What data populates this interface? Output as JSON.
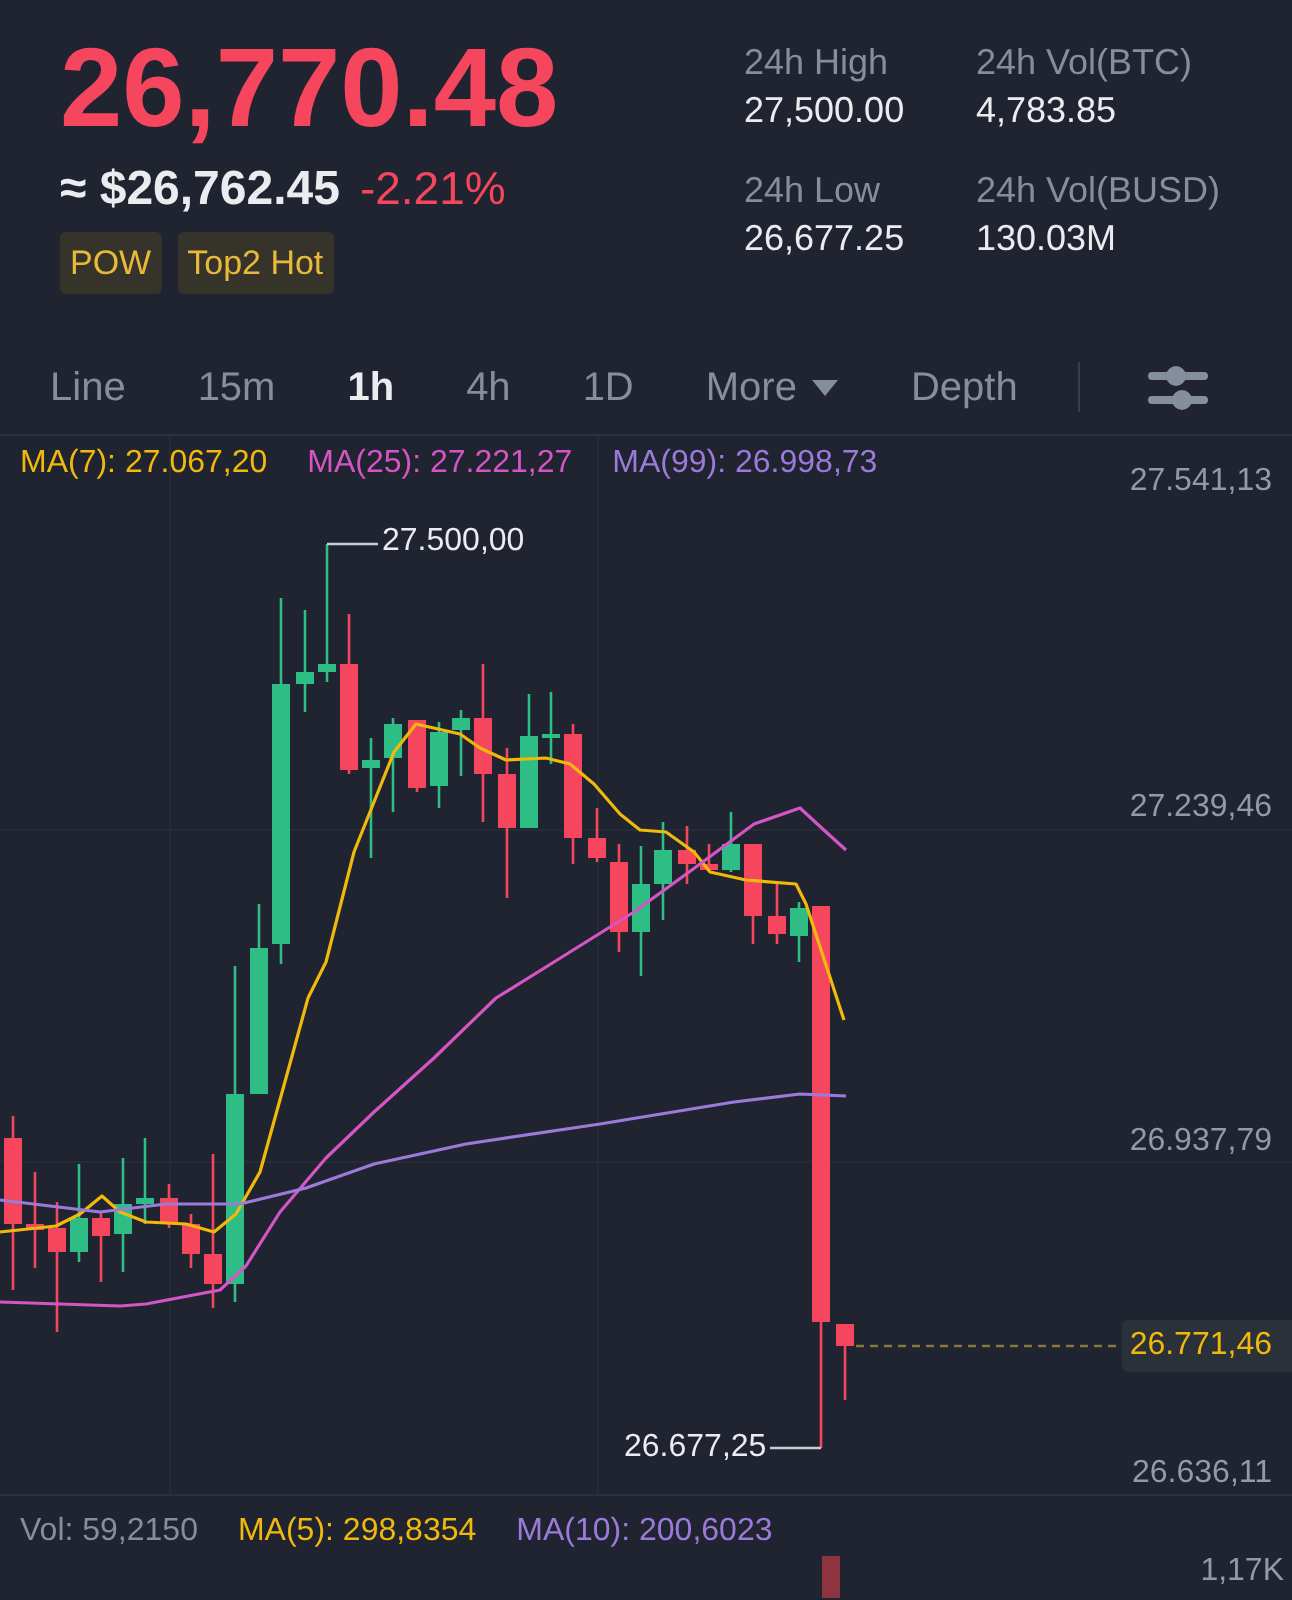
{
  "ticker": {
    "price": "26,770.48",
    "fiat_price": "≈ $26,762.45",
    "change": "-2.21%",
    "tags": [
      "POW",
      "Top2 Hot"
    ]
  },
  "stats": [
    {
      "label": "24h High",
      "value": "27,500.00"
    },
    {
      "label": "24h Vol(BTC)",
      "value": "4,783.85"
    },
    {
      "label": "24h Low",
      "value": "26,677.25"
    },
    {
      "label": "24h Vol(BUSD)",
      "value": "130.03M"
    }
  ],
  "intervals": [
    {
      "label": "Line",
      "selected": false,
      "dropdown": false
    },
    {
      "label": "15m",
      "selected": false,
      "dropdown": false
    },
    {
      "label": "1h",
      "selected": true,
      "dropdown": false
    },
    {
      "label": "4h",
      "selected": false,
      "dropdown": false
    },
    {
      "label": "1D",
      "selected": false,
      "dropdown": false
    },
    {
      "label": "More",
      "selected": false,
      "dropdown": true
    },
    {
      "label": "Depth",
      "selected": false,
      "dropdown": false
    }
  ],
  "chart": {
    "ma_legend": [
      {
        "label": "MA(7): 27.067,20",
        "color": "#f0b90b"
      },
      {
        "label": "MA(25): 27.221,27",
        "color": "#d555c5"
      },
      {
        "label": "MA(99): 26.998,73",
        "color": "#9c7ad9"
      }
    ],
    "price_axis": [
      "27.541,13",
      "27.239,46",
      "26.937,79",
      "26.636,11"
    ],
    "high_label": "27.500,00",
    "low_label": "26.677,25",
    "last_price": "26.771,46"
  },
  "volume": {
    "legend": [
      {
        "label": "Vol: 59,2150",
        "color": "#848e9c"
      },
      {
        "label": "MA(5): 298,8354",
        "color": "#f0b90b"
      },
      {
        "label": "MA(10): 200,6023",
        "color": "#9c7ad9"
      }
    ],
    "axis_label": "1,17K"
  }
}
